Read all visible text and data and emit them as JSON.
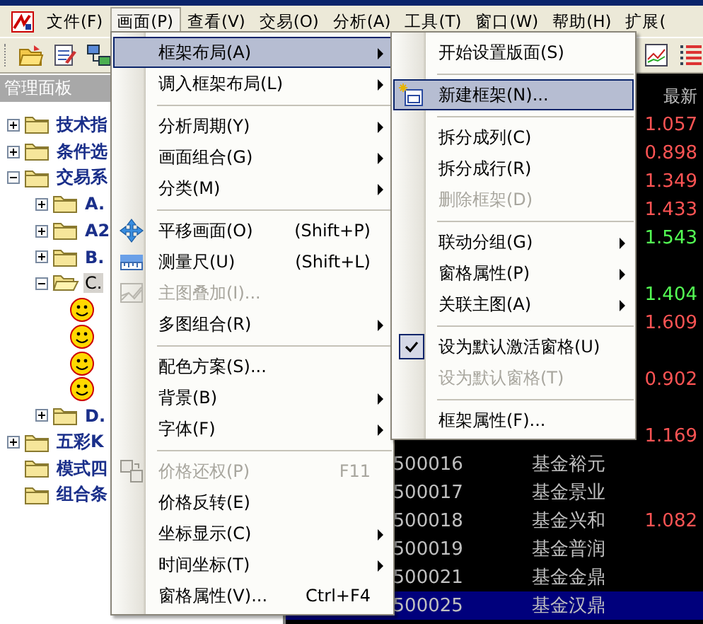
{
  "menubar": [
    {
      "label": "文件(F)",
      "selected": false
    },
    {
      "label": "画面(P)",
      "selected": true
    },
    {
      "label": "查看(V)",
      "selected": false
    },
    {
      "label": "交易(O)",
      "selected": false
    },
    {
      "label": "分析(A)",
      "selected": false
    },
    {
      "label": "工具(T)",
      "selected": false
    },
    {
      "label": "窗口(W)",
      "selected": false
    },
    {
      "label": "帮助(H)",
      "selected": false
    },
    {
      "label": "扩展(",
      "selected": false
    }
  ],
  "panel": {
    "title": "管理面板",
    "tree": [
      {
        "kind": "group",
        "label": "技术指",
        "expanded": false,
        "selected": false
      },
      {
        "kind": "group",
        "label": "条件选",
        "expanded": false,
        "selected": false
      },
      {
        "kind": "group",
        "label": "交易系",
        "expanded": true,
        "selected": false,
        "children": [
          {
            "kind": "group",
            "label": "A.",
            "expanded": false,
            "selected": false
          },
          {
            "kind": "group",
            "label": "A2",
            "expanded": false,
            "selected": false
          },
          {
            "kind": "group",
            "label": "B.",
            "expanded": false,
            "selected": false
          },
          {
            "kind": "group",
            "label": "C.",
            "expanded": true,
            "selected": true,
            "children": [
              {
                "kind": "leaf",
                "selected": false
              },
              {
                "kind": "leaf",
                "selected": false
              },
              {
                "kind": "leaf",
                "selected": false
              },
              {
                "kind": "leaf",
                "selected": false
              }
            ]
          },
          {
            "kind": "group",
            "label": "D.",
            "expanded": false,
            "selected": false
          }
        ]
      },
      {
        "kind": "group",
        "label": "五彩K",
        "expanded": false,
        "selected": false
      },
      {
        "kind": "folder",
        "label": "模式四",
        "selected": false
      },
      {
        "kind": "folder",
        "label": "组合条",
        "selected": false
      }
    ]
  },
  "grid": {
    "header": "最新",
    "rows": [
      {
        "price": "1.057",
        "color": "#ff5454",
        "selected": false
      },
      {
        "price": "0.898",
        "color": "#ff5454",
        "selected": false
      },
      {
        "price": "1.349",
        "color": "#ff5454",
        "selected": false
      },
      {
        "price": "1.433",
        "color": "#ff5454",
        "selected": false
      },
      {
        "price": "1.543",
        "color": "#54ff54",
        "selected": false
      },
      {
        "selected": false
      },
      {
        "price": "1.404",
        "color": "#54ff54",
        "selected": false
      },
      {
        "price": "1.609",
        "color": "#ff5454",
        "selected": false
      },
      {
        "selected": false
      },
      {
        "price": "0.902",
        "color": "#ff5454",
        "selected": false
      },
      {
        "selected": false
      },
      {
        "price": "1.169",
        "color": "#ff5454",
        "selected": false
      },
      {
        "code": "500016",
        "name": "基金裕元",
        "selected": false
      },
      {
        "code": "500017",
        "name": "基金景业",
        "selected": false
      },
      {
        "code": "500018",
        "name": "基金兴和",
        "price": "1.082",
        "color": "#ff5454",
        "selected": false
      },
      {
        "code": "500019",
        "name": "基金普润",
        "selected": false
      },
      {
        "code": "500021",
        "name": "基金金鼎",
        "selected": false
      },
      {
        "code": "500025",
        "name": "基金汉鼎",
        "selected": true
      }
    ]
  },
  "menu": [
    {
      "kind": "item",
      "label": "框架布局(A)",
      "submenu": true,
      "disabled": false,
      "selected": true
    },
    {
      "kind": "item",
      "label": "调入框架布局(L)",
      "submenu": true,
      "disabled": false,
      "selected": false
    },
    {
      "kind": "separator"
    },
    {
      "kind": "item",
      "label": "分析周期(Y)",
      "submenu": true,
      "disabled": false,
      "selected": false
    },
    {
      "kind": "item",
      "label": "画面组合(G)",
      "submenu": true,
      "disabled": false,
      "selected": false
    },
    {
      "kind": "item",
      "label": "分类(M)",
      "submenu": true,
      "disabled": false,
      "selected": false
    },
    {
      "kind": "separator"
    },
    {
      "kind": "item",
      "label": "平移画面(O)",
      "shortcut": "(Shift+P)",
      "submenu": false,
      "disabled": false,
      "selected": false
    },
    {
      "kind": "item",
      "label": "测量尺(U)",
      "shortcut": "(Shift+L)",
      "submenu": false,
      "disabled": false,
      "selected": false
    },
    {
      "kind": "item",
      "label": "主图叠加(I)...",
      "submenu": false,
      "disabled": true,
      "selected": false
    },
    {
      "kind": "item",
      "label": "多图组合(R)",
      "submenu": true,
      "disabled": false,
      "selected": false
    },
    {
      "kind": "separator"
    },
    {
      "kind": "item",
      "label": "配色方案(S)...",
      "submenu": false,
      "disabled": false,
      "selected": false
    },
    {
      "kind": "item",
      "label": "背景(B)",
      "submenu": true,
      "disabled": false,
      "selected": false
    },
    {
      "kind": "item",
      "label": "字体(F)",
      "submenu": true,
      "disabled": false,
      "selected": false
    },
    {
      "kind": "separator"
    },
    {
      "kind": "item",
      "label": "价格还权(P)",
      "shortcut": "F11",
      "submenu": false,
      "disabled": true,
      "selected": false
    },
    {
      "kind": "item",
      "label": "价格反转(E)",
      "submenu": false,
      "disabled": false,
      "selected": false
    },
    {
      "kind": "item",
      "label": "坐标显示(C)",
      "submenu": true,
      "disabled": false,
      "selected": false
    },
    {
      "kind": "item",
      "label": "时间坐标(T)",
      "submenu": true,
      "disabled": false,
      "selected": false
    },
    {
      "kind": "item",
      "label": "窗格属性(V)...",
      "shortcut": "Ctrl+F4",
      "submenu": false,
      "disabled": false,
      "selected": false
    }
  ],
  "submenu": [
    {
      "kind": "item",
      "label": "开始设置版面(S)",
      "submenu": false,
      "disabled": false,
      "selected": false,
      "checked": false
    },
    {
      "kind": "separator"
    },
    {
      "kind": "item",
      "label": "新建框架(N)...",
      "submenu": false,
      "disabled": false,
      "selected": true,
      "checked": false
    },
    {
      "kind": "separator"
    },
    {
      "kind": "item",
      "label": "拆分成列(C)",
      "submenu": false,
      "disabled": false,
      "selected": false,
      "checked": false
    },
    {
      "kind": "item",
      "label": "拆分成行(R)",
      "submenu": false,
      "disabled": false,
      "selected": false,
      "checked": false
    },
    {
      "kind": "item",
      "label": "删除框架(D)",
      "submenu": false,
      "disabled": true,
      "selected": false,
      "checked": false
    },
    {
      "kind": "separator"
    },
    {
      "kind": "item",
      "label": "联动分组(G)",
      "submenu": true,
      "disabled": false,
      "selected": false,
      "checked": false
    },
    {
      "kind": "item",
      "label": "窗格属性(P)",
      "submenu": true,
      "disabled": false,
      "selected": false,
      "checked": false
    },
    {
      "kind": "item",
      "label": "关联主图(A)",
      "submenu": true,
      "disabled": false,
      "selected": false,
      "checked": false
    },
    {
      "kind": "separator"
    },
    {
      "kind": "item",
      "label": "设为默认激活窗格(U)",
      "submenu": false,
      "disabled": false,
      "selected": false,
      "checked": true
    },
    {
      "kind": "item",
      "label": "设为默认窗格(T)",
      "submenu": false,
      "disabled": true,
      "selected": false,
      "checked": false
    },
    {
      "kind": "separator"
    },
    {
      "kind": "item",
      "label": "框架属性(F)...",
      "submenu": false,
      "disabled": false,
      "selected": false,
      "checked": false
    }
  ]
}
